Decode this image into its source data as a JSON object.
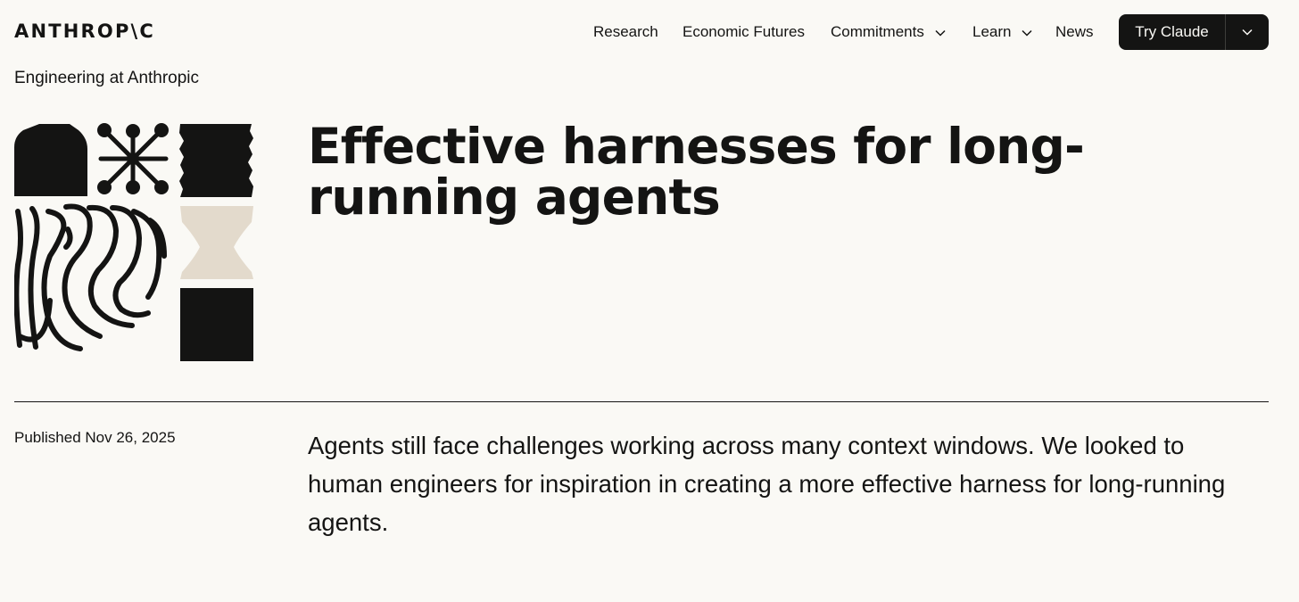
{
  "header": {
    "logo_text": "ANTHROP\\C",
    "nav": [
      {
        "label": "Research",
        "has_dropdown": false
      },
      {
        "label": "Economic Futures",
        "has_dropdown": false
      },
      {
        "label": "Commitments",
        "has_dropdown": true
      },
      {
        "label": "Learn",
        "has_dropdown": true
      },
      {
        "label": "News",
        "has_dropdown": false
      }
    ],
    "cta": {
      "label": "Try Claude",
      "dropdown_icon": "chevron-down-icon"
    }
  },
  "eyebrow": "Engineering at Anthropic",
  "article": {
    "title": "Effective harnesses for long-running agents",
    "published": "Published Nov 26, 2025",
    "summary": "Agents still face challenges working across many context windows. We looked to human engineers for inspiration in creating a more effective harness for long-running agents."
  },
  "colors": {
    "background": "#faf9f5",
    "text": "#141413",
    "accent_beige": "#e3dacc"
  }
}
